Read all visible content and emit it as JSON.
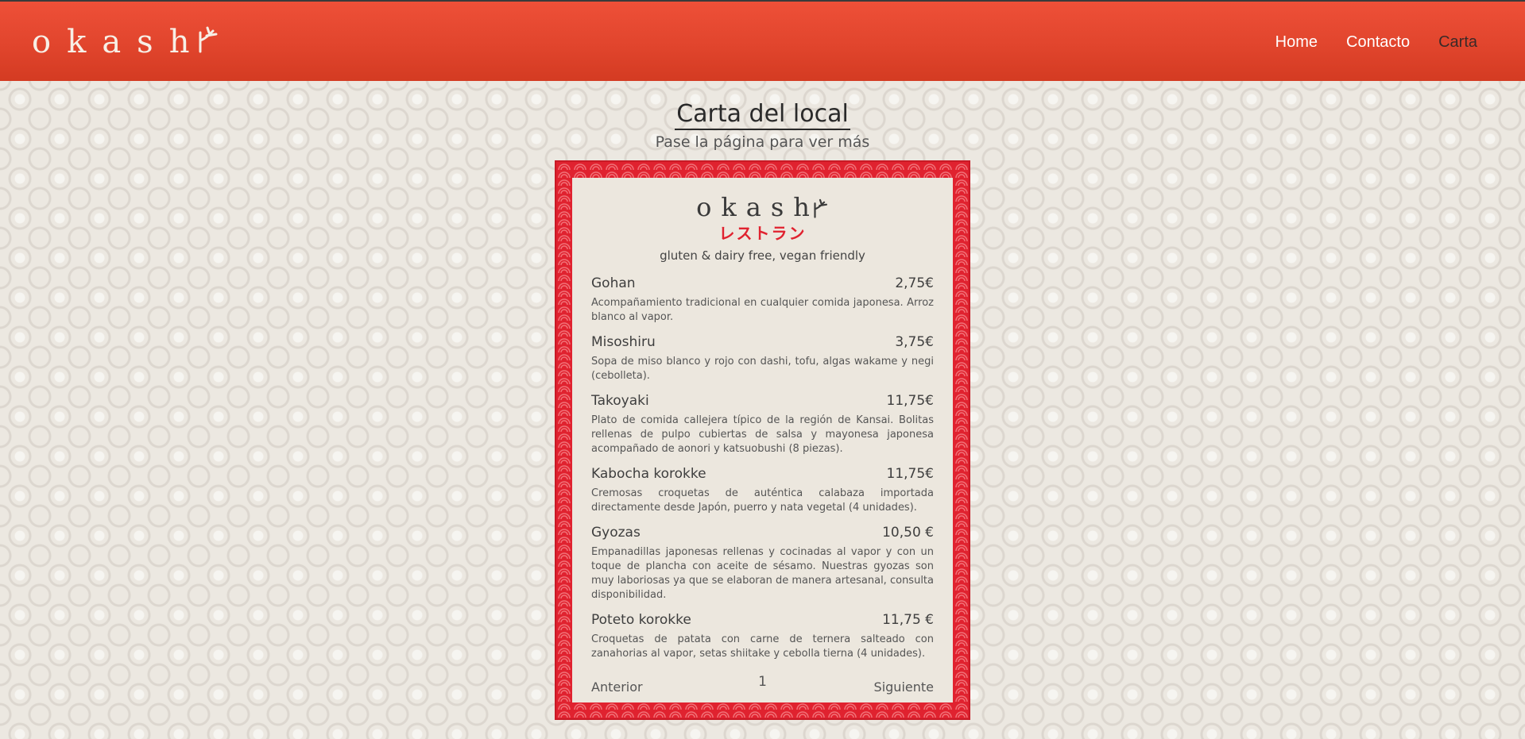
{
  "header": {
    "logo_text": "okash",
    "nav": [
      {
        "label": "Home"
      },
      {
        "label": "Contacto"
      },
      {
        "label": "Carta"
      }
    ]
  },
  "page": {
    "title": "Carta del local",
    "subtitle": "Pase la página para ver más"
  },
  "menu": {
    "logo_text": "okash",
    "japanese": "レストラン",
    "tagline": "gluten & dairy free, vegan friendly",
    "items": [
      {
        "name": "Gohan",
        "price": "2,75€",
        "desc": "Acompañamiento tradicional en cualquier comida japonesa. Arroz blanco al vapor."
      },
      {
        "name": "Misoshiru",
        "price": "3,75€",
        "desc": "Sopa de miso blanco y rojo con dashi, tofu, algas wakame y negi (cebolleta)."
      },
      {
        "name": "Takoyaki",
        "price": "11,75€",
        "desc": "Plato de comida callejera típico de la región de Kansai. Bolitas rellenas de pulpo cubiertas de salsa y mayonesa japonesa acompañado de aonori y katsuobushi (8 piezas)."
      },
      {
        "name": "Kabocha korokke",
        "price": "11,75€",
        "desc": "Cremosas croquetas de auténtica calabaza importada directamente desde Japón, puerro y nata vegetal (4 unidades)."
      },
      {
        "name": "Gyozas",
        "price": "10,50 €",
        "desc": "Empanadillas japonesas rellenas y cocinadas al vapor y con un toque de plancha con aceite de sésamo. Nuestras gyozas son muy laboriosas ya que se elaboran de manera artesanal, consulta disponibilidad."
      },
      {
        "name": "Poteto korokke",
        "price": "11,75 €",
        "desc": "Croquetas de patata con carne de ternera salteado con zanahorias al vapor, setas shiitake y cebolla tierna (4 unidades)."
      }
    ],
    "pager": {
      "prev": "Anterior",
      "page": "1",
      "next": "Siguiente"
    }
  },
  "colors": {
    "header": "#e1452d",
    "frame": "#e0222f",
    "card": "#ece7de",
    "accent_jp": "#e0222f"
  },
  "icons": {
    "logo_mark": "sprout-icon"
  }
}
